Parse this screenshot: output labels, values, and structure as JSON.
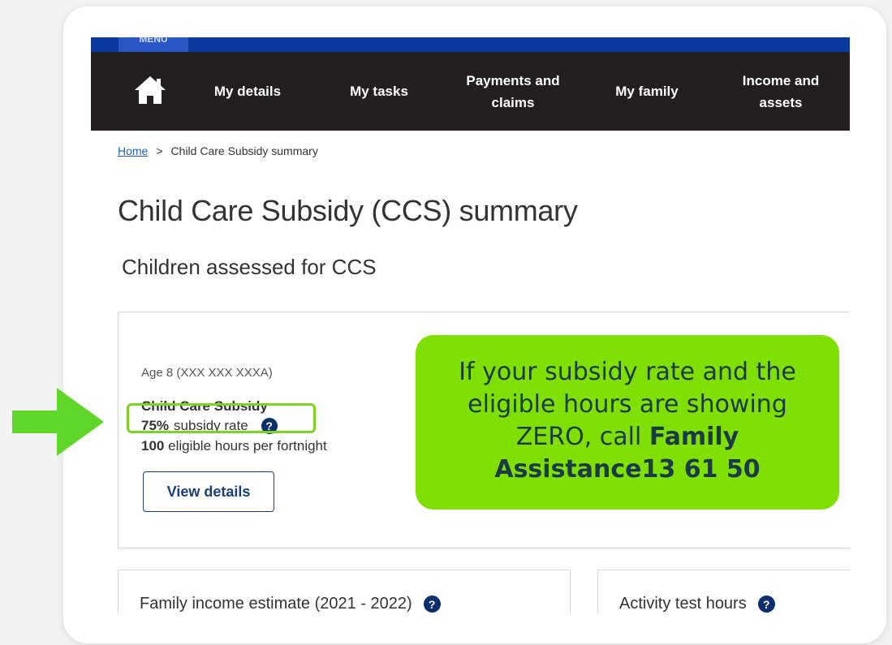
{
  "header": {
    "menu_label": "MENU"
  },
  "nav": {
    "home_icon": "home-icon",
    "items": [
      {
        "label": "My details"
      },
      {
        "label": "My tasks"
      },
      {
        "label": "Payments and claims"
      },
      {
        "label": "My family"
      },
      {
        "label": "Income and assets"
      }
    ]
  },
  "breadcrumb": {
    "home": "Home",
    "separator": ">",
    "current": "Child Care Subsidy summary"
  },
  "page": {
    "title": "Child Care Subsidy (CCS) summary",
    "section_title": "Children assessed for CCS"
  },
  "child": {
    "age_line": "Age 8 (XXX XXX XXXA)",
    "ccs_label": "Child Care Subsidy",
    "rate_value": "75%",
    "rate_text": "subsidy rate",
    "hours_value": "100",
    "hours_text": "eligible hours per fortnight",
    "view_button": "View details"
  },
  "bottom_cards": [
    {
      "label": "Family income estimate (2021 - 2022)"
    },
    {
      "label": "Activity test hours"
    }
  ],
  "callout": {
    "line1": "If your subsidy rate and the",
    "line2": "eligible hours are showing",
    "line3_a": "ZERO, call ",
    "line3_b": "Family",
    "line4": "Assistance13 61 50"
  },
  "colors": {
    "nav_bg": "#231f20",
    "top_bar": "#0a3a9e",
    "callout_bg": "#7fe000",
    "arrow": "#5ed62a",
    "link": "#1e5fb4"
  }
}
